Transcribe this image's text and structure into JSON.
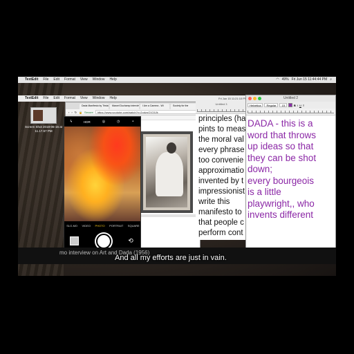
{
  "menubar": {
    "app": "TextEdit",
    "items": [
      "File",
      "Edit",
      "Format",
      "View",
      "Window",
      "Help"
    ],
    "status": "Fri Jun 15 11:44:44 PM",
    "battery": "49%"
  },
  "back_menubar": {
    "app": "TextEdit",
    "items": [
      "File",
      "Edit",
      "Format",
      "View",
      "Window",
      "Help"
    ],
    "clock": "Fri Jun 15 11:21:10 PM"
  },
  "desktop": {
    "file_label": "Screen Shot 2018-06-15 at 11.17.57 PM"
  },
  "browser": {
    "tabs": [
      "Dada Manifesto by Tristan Tz",
      "Marcel Duchamp interview",
      "I Am a Camera - Wi",
      "Society for the"
    ],
    "secure_label": "Secure",
    "url": "https://www.youtube.com/watch?v=2odzoQ1C6Jk"
  },
  "back_doc": {
    "title": "Untitled 3",
    "lines": [
      "principles (ha",
      "pints to meas",
      "the moral val",
      "every phrase",
      "too convenie",
      "approximatio",
      "invented by t",
      "impressionist",
      "write this",
      "manifesto to",
      "that people c",
      "perform cont"
    ]
  },
  "phone_camera": {
    "hdr": "HDR",
    "modes": [
      "SLO-MO",
      "VIDEO",
      "PHOTO",
      "PORTRAIT",
      "SQUARE"
    ],
    "active_mode": "PHOTO"
  },
  "textedit": {
    "title": "Untitled 2",
    "font_family": "Helvetica",
    "font_style": "Regular",
    "font_size": "15",
    "text_color": "#8b27a6",
    "lines": [
      "DADA - this is a",
      "word that throws",
      "up ideas so that",
      "they can be shot",
      "down;",
      "every bourgeois",
      "is a little",
      "playwright,, who",
      "invents different"
    ]
  },
  "captions": {
    "small": "mo interview on Art and Dada (1956)",
    "subtitle": "And all my efforts are just in vain."
  }
}
